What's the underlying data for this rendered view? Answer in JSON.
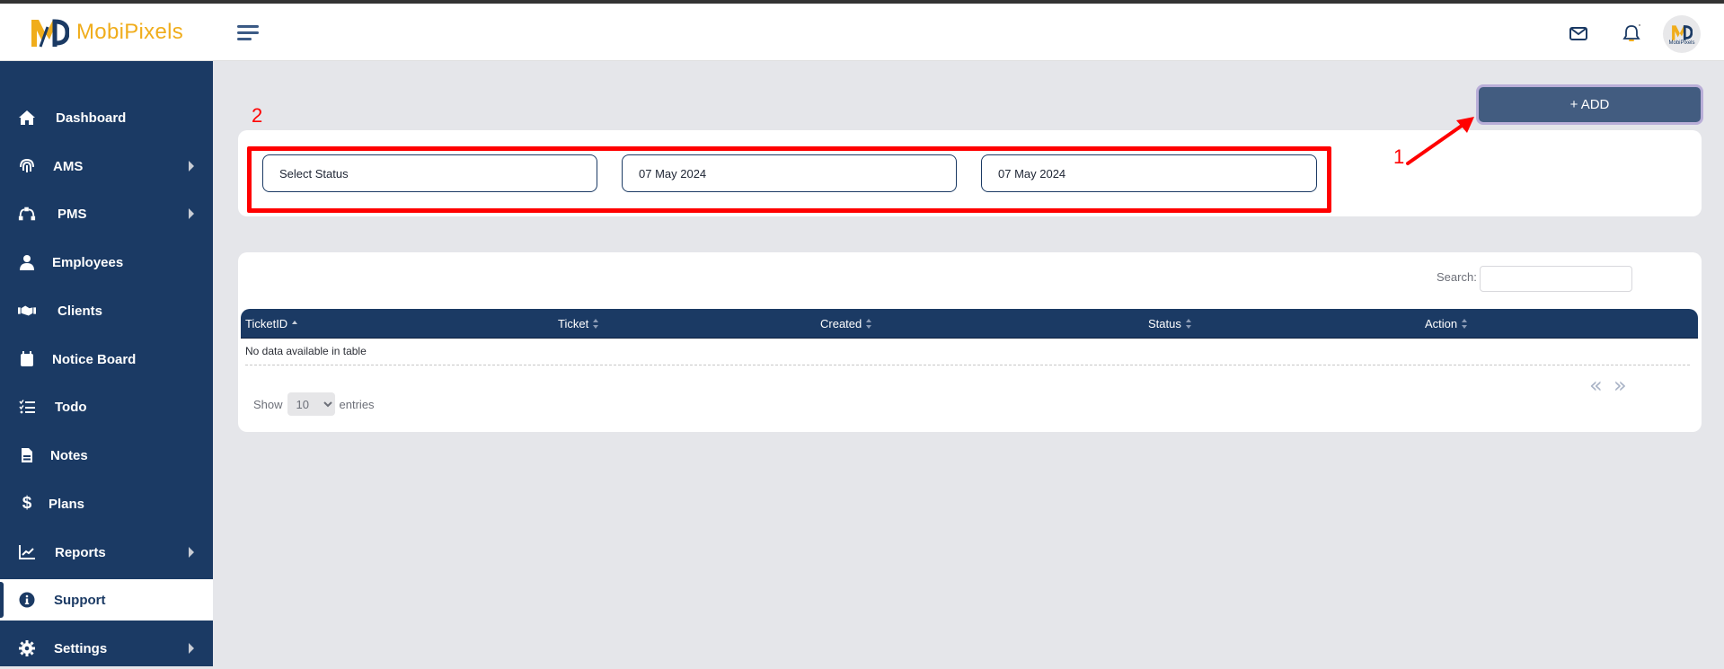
{
  "app": {
    "brand_name": "MobiPixels",
    "avatar_label": "MobiPixels",
    "colors": {
      "sidebar": "#1b3a64",
      "brand_gold": "#f0ad1c",
      "add_button": "#425c80",
      "annotation": "#ff0000"
    }
  },
  "header": {
    "icons": [
      "menu-icon",
      "mail-icon",
      "bell-icon",
      "avatar"
    ]
  },
  "sidebar": {
    "items": [
      {
        "label": "Dashboard",
        "icon": "home-icon",
        "has_submenu": false,
        "active": false
      },
      {
        "label": "AMS",
        "icon": "fingerprint-icon",
        "has_submenu": true,
        "active": false
      },
      {
        "label": "PMS",
        "icon": "bezier-icon",
        "has_submenu": true,
        "active": false
      },
      {
        "label": "Employees",
        "icon": "user-icon",
        "has_submenu": false,
        "active": false
      },
      {
        "label": "Clients",
        "icon": "handshake-icon",
        "has_submenu": false,
        "active": false
      },
      {
        "label": "Notice Board",
        "icon": "calendar-icon",
        "has_submenu": false,
        "active": false
      },
      {
        "label": "Todo",
        "icon": "checklist-icon",
        "has_submenu": false,
        "active": false
      },
      {
        "label": "Notes",
        "icon": "note-icon",
        "has_submenu": false,
        "active": false
      },
      {
        "label": "Plans",
        "icon": "dollar-icon",
        "has_submenu": false,
        "active": false
      },
      {
        "label": "Reports",
        "icon": "chart-line-icon",
        "has_submenu": true,
        "active": false
      },
      {
        "label": "Support",
        "icon": "info-icon",
        "has_submenu": false,
        "active": true
      },
      {
        "label": "Settings",
        "icon": "gear-icon",
        "has_submenu": true,
        "active": false
      }
    ]
  },
  "toolbar": {
    "add_label": "+ ADD"
  },
  "filters": {
    "status_placeholder": "Select Status",
    "start_date": "07 May 2024",
    "end_date": "07 May 2024"
  },
  "annotations": {
    "one": "1",
    "two": "2"
  },
  "table": {
    "search_label": "Search:",
    "search_value": "",
    "columns": [
      {
        "label": "TicketID",
        "sort": "asc"
      },
      {
        "label": "Ticket",
        "sort": "both"
      },
      {
        "label": "Created",
        "sort": "both"
      },
      {
        "label": "Status",
        "sort": "both"
      },
      {
        "label": "Action",
        "sort": "both"
      }
    ],
    "empty_message": "No data available in table",
    "length": {
      "prefix": "Show",
      "selected": "10",
      "suffix": "entries"
    },
    "pager": {
      "prev": "«",
      "next": "»"
    }
  }
}
